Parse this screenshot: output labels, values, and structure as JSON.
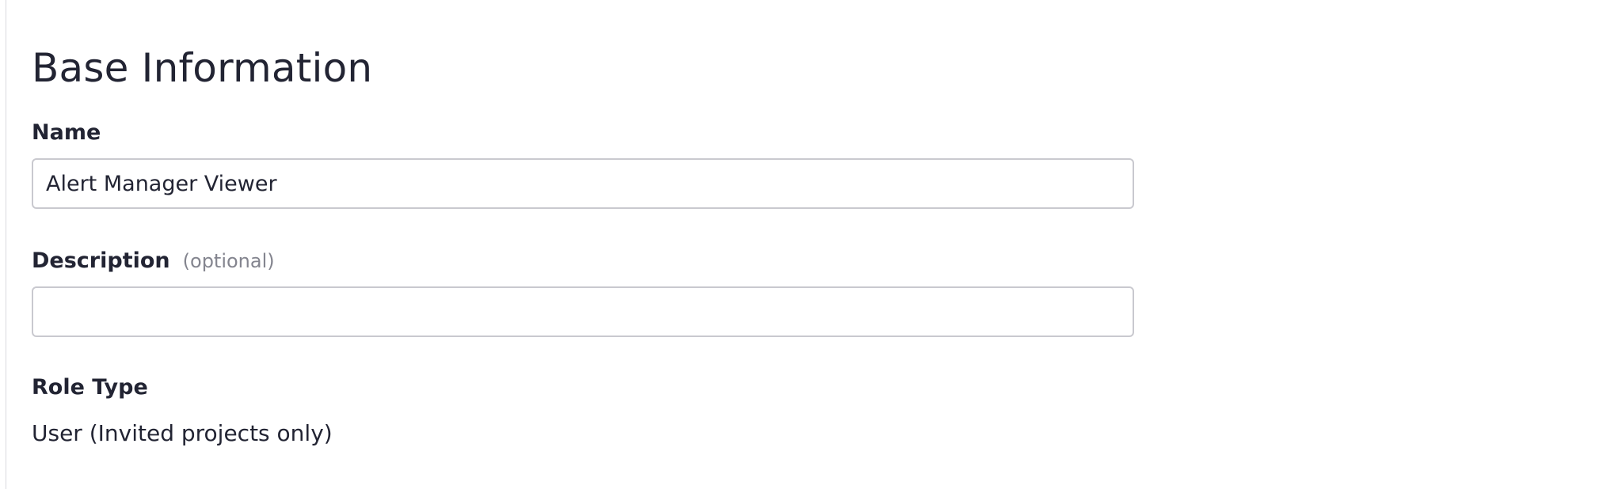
{
  "section": {
    "title": "Base Information"
  },
  "fields": {
    "name": {
      "label": "Name",
      "value": "Alert Manager Viewer"
    },
    "description": {
      "label": "Description",
      "optional_hint": "(optional)",
      "value": ""
    },
    "role_type": {
      "label": "Role Type",
      "value": "User (Invited projects only)"
    }
  },
  "colors": {
    "text": "#222433",
    "muted": "#84858f",
    "input_border": "#c9c9cf"
  }
}
